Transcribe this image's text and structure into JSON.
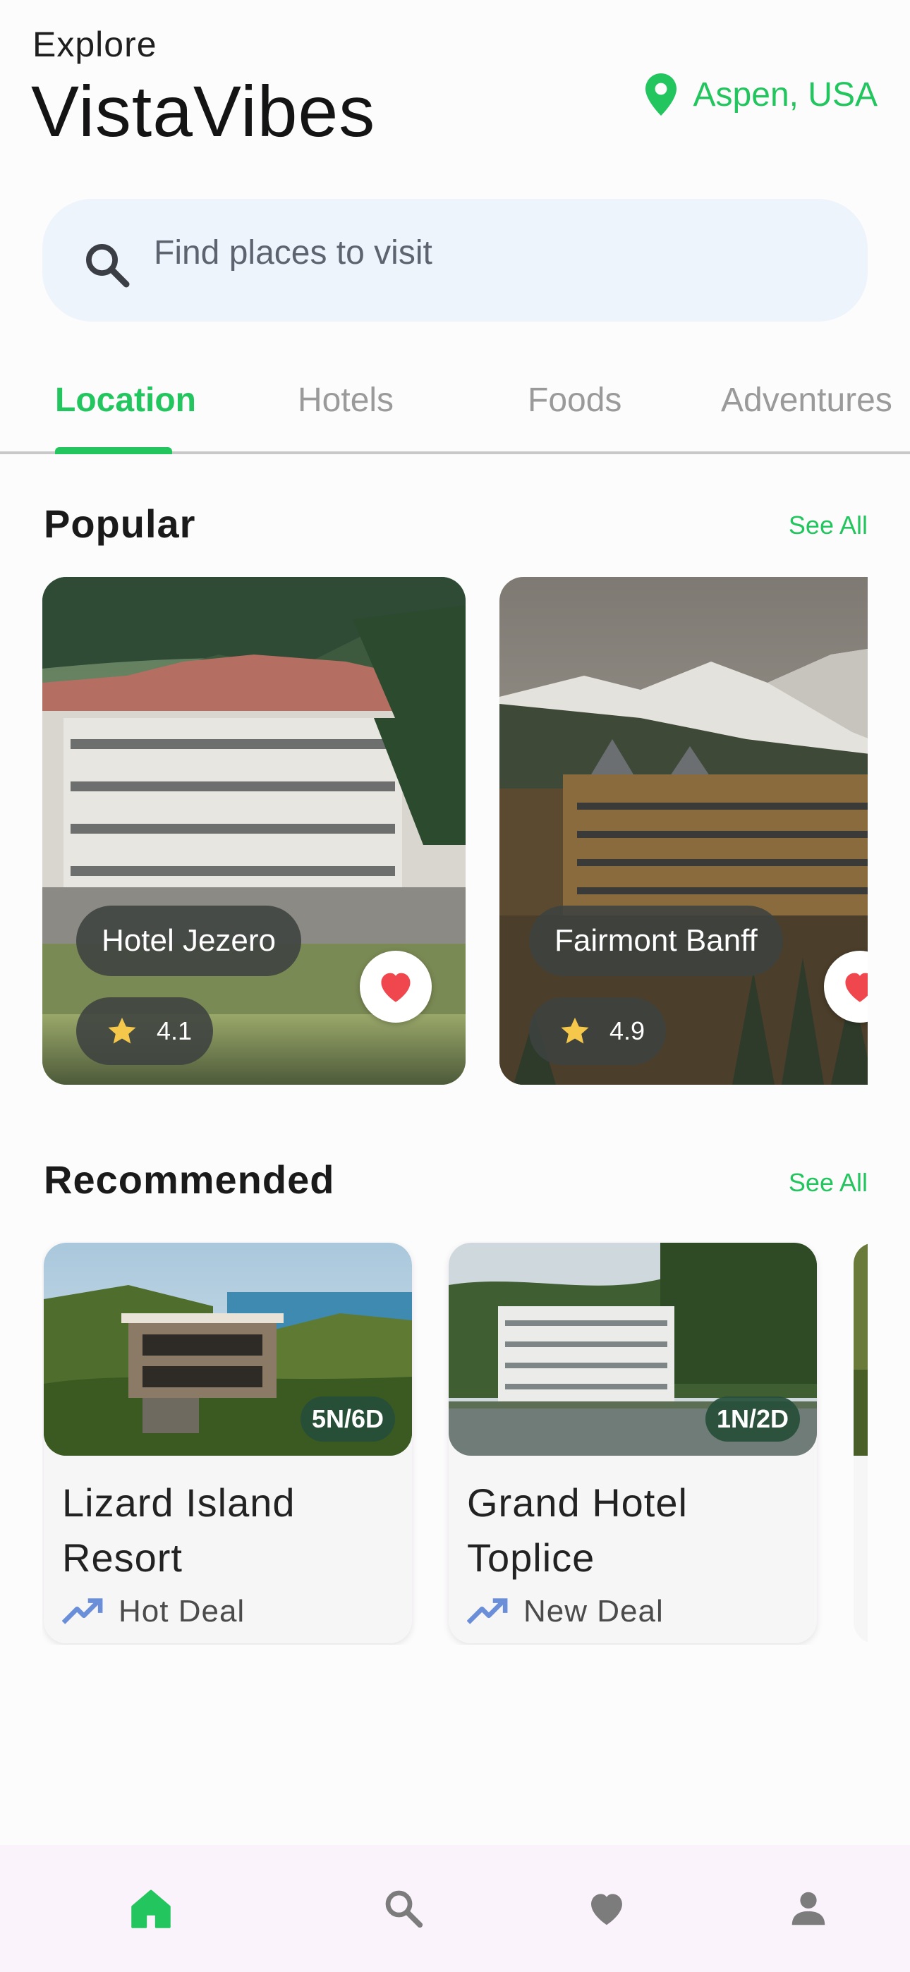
{
  "header": {
    "eyebrow": "Explore",
    "brand": "VistaVibes",
    "location": "Aspen, USA",
    "location_icon": "map-pin-icon",
    "accent_color": "#22c55e"
  },
  "search": {
    "placeholder": "Find places to visit",
    "value": "",
    "icon": "search-icon"
  },
  "tabs": [
    {
      "label": "Location",
      "active": true
    },
    {
      "label": "Hotels",
      "active": false
    },
    {
      "label": "Foods",
      "active": false
    },
    {
      "label": "Adventures",
      "active": false
    }
  ],
  "popular": {
    "title": "Popular",
    "see_all": "See All",
    "cards": [
      {
        "name": "Hotel Jezero",
        "rating": "4.1",
        "favorite": true
      },
      {
        "name": "Fairmont Banff",
        "rating": "4.9",
        "favorite": true
      }
    ]
  },
  "recommended": {
    "title": "Recommended",
    "see_all": "See All",
    "cards": [
      {
        "title": "Lizard Island Resort",
        "duration": "5N/6D",
        "deal": "Hot Deal",
        "deal_icon": "trending-up-icon"
      },
      {
        "title": "Grand Hotel Toplice",
        "duration": "1N/2D",
        "deal": "New Deal",
        "deal_icon": "trending-up-icon"
      }
    ]
  },
  "bottom_nav": [
    {
      "icon": "home-icon",
      "active": true
    },
    {
      "icon": "search-icon",
      "active": false
    },
    {
      "icon": "heart-icon",
      "active": false
    },
    {
      "icon": "profile-icon",
      "active": false
    }
  ]
}
